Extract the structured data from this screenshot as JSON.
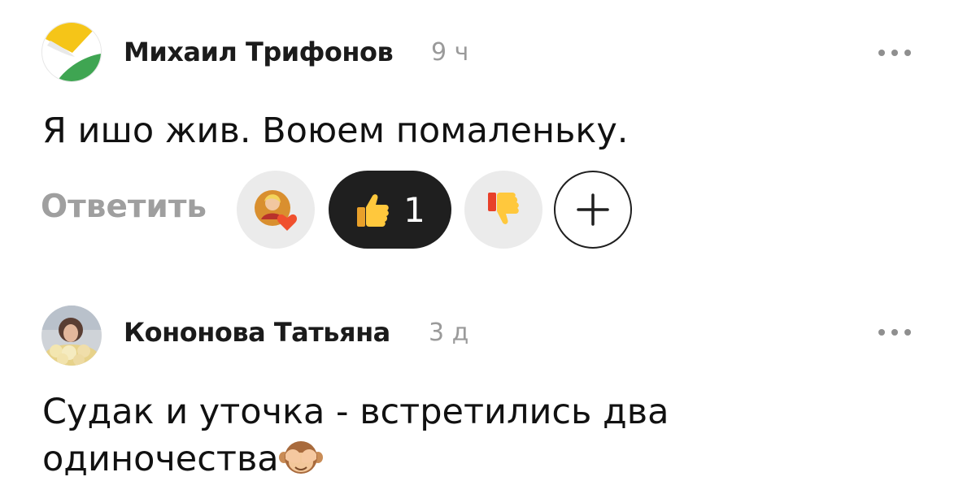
{
  "comments": [
    {
      "author": "Михаил Трифонов",
      "time": "9 ч",
      "text": "Я ишо жив. Воюем помаленьку.",
      "reply_label": "Ответить",
      "reactions": {
        "like_count": "1"
      },
      "avatar_icon": "yellow-green-circle-logo",
      "colors": {
        "like_pill": "#1f1f1f",
        "reaction_pill": "#ebebeb"
      }
    },
    {
      "author": "Кононова Татьяна",
      "time": "3 д",
      "text_line1": "Судак и уточка - встретились два",
      "text_line2": "одиночества",
      "text_emoji": "see-no-evil-monkey",
      "avatar_icon": "user-photo"
    }
  ]
}
